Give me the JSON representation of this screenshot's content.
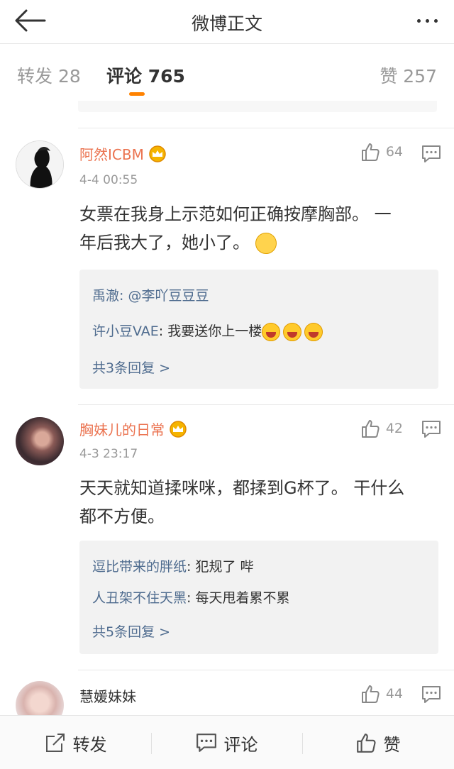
{
  "header": {
    "title": "微博正文",
    "back_icon": "arrow-left-icon",
    "more_icon": "more-dots-icon"
  },
  "tabs": [
    {
      "label": "转发",
      "count": "28",
      "active": false
    },
    {
      "label": "评论",
      "count": "765",
      "active": true
    },
    {
      "label": "赞",
      "count": "257",
      "active": false
    }
  ],
  "comments": [
    {
      "user": "阿然ICBM",
      "time": "4-4 00:55",
      "likes": "64",
      "text_line1": "女票在我身上示范如何正确按摩胸部。 一",
      "text_line2": "年后我大了，她小了。",
      "replies": [
        {
          "name": "禹澈",
          "sep": ": ",
          "text": "@李吖豆豆豆"
        },
        {
          "name": "许小豆VAE",
          "sep": ": ",
          "text": "我要送你上一楼"
        }
      ],
      "more": "共3条回复 >"
    },
    {
      "user": "胸妹儿的日常",
      "time": "4-3 23:17",
      "likes": "42",
      "text_line1": "天天就知道揉咪咪，都揉到G杯了。 干什么",
      "text_line2": "都不方便。",
      "replies": [
        {
          "name": "逗比带来的胖纸",
          "sep": ": ",
          "text": "犯规了 哔"
        },
        {
          "name": "人丑架不住天黑",
          "sep": ": ",
          "text": "每天甩着累不累"
        }
      ],
      "more": "共5条回复 >"
    },
    {
      "user": "慧媛妹妹",
      "likes": "44"
    }
  ],
  "bottom": {
    "repost": "转发",
    "comment": "评论",
    "like": "赞"
  },
  "colors": {
    "accent": "#ff8200",
    "username": "#eb7350",
    "reply_name": "#4e6b8e"
  }
}
